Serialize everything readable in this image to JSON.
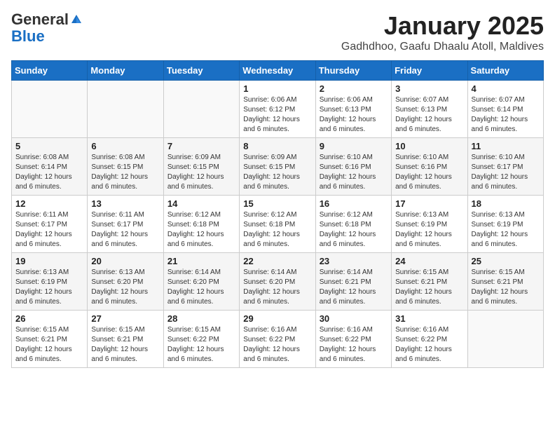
{
  "logo": {
    "general": "General",
    "blue": "Blue"
  },
  "title": "January 2025",
  "subtitle": "Gadhdhoo, Gaafu Dhaalu Atoll, Maldives",
  "headers": [
    "Sunday",
    "Monday",
    "Tuesday",
    "Wednesday",
    "Thursday",
    "Friday",
    "Saturday"
  ],
  "weeks": [
    [
      {
        "day": "",
        "info": ""
      },
      {
        "day": "",
        "info": ""
      },
      {
        "day": "",
        "info": ""
      },
      {
        "day": "1",
        "info": "Sunrise: 6:06 AM\nSunset: 6:12 PM\nDaylight: 12 hours and 6 minutes."
      },
      {
        "day": "2",
        "info": "Sunrise: 6:06 AM\nSunset: 6:13 PM\nDaylight: 12 hours and 6 minutes."
      },
      {
        "day": "3",
        "info": "Sunrise: 6:07 AM\nSunset: 6:13 PM\nDaylight: 12 hours and 6 minutes."
      },
      {
        "day": "4",
        "info": "Sunrise: 6:07 AM\nSunset: 6:14 PM\nDaylight: 12 hours and 6 minutes."
      }
    ],
    [
      {
        "day": "5",
        "info": "Sunrise: 6:08 AM\nSunset: 6:14 PM\nDaylight: 12 hours and 6 minutes."
      },
      {
        "day": "6",
        "info": "Sunrise: 6:08 AM\nSunset: 6:15 PM\nDaylight: 12 hours and 6 minutes."
      },
      {
        "day": "7",
        "info": "Sunrise: 6:09 AM\nSunset: 6:15 PM\nDaylight: 12 hours and 6 minutes."
      },
      {
        "day": "8",
        "info": "Sunrise: 6:09 AM\nSunset: 6:15 PM\nDaylight: 12 hours and 6 minutes."
      },
      {
        "day": "9",
        "info": "Sunrise: 6:10 AM\nSunset: 6:16 PM\nDaylight: 12 hours and 6 minutes."
      },
      {
        "day": "10",
        "info": "Sunrise: 6:10 AM\nSunset: 6:16 PM\nDaylight: 12 hours and 6 minutes."
      },
      {
        "day": "11",
        "info": "Sunrise: 6:10 AM\nSunset: 6:17 PM\nDaylight: 12 hours and 6 minutes."
      }
    ],
    [
      {
        "day": "12",
        "info": "Sunrise: 6:11 AM\nSunset: 6:17 PM\nDaylight: 12 hours and 6 minutes."
      },
      {
        "day": "13",
        "info": "Sunrise: 6:11 AM\nSunset: 6:17 PM\nDaylight: 12 hours and 6 minutes."
      },
      {
        "day": "14",
        "info": "Sunrise: 6:12 AM\nSunset: 6:18 PM\nDaylight: 12 hours and 6 minutes."
      },
      {
        "day": "15",
        "info": "Sunrise: 6:12 AM\nSunset: 6:18 PM\nDaylight: 12 hours and 6 minutes."
      },
      {
        "day": "16",
        "info": "Sunrise: 6:12 AM\nSunset: 6:18 PM\nDaylight: 12 hours and 6 minutes."
      },
      {
        "day": "17",
        "info": "Sunrise: 6:13 AM\nSunset: 6:19 PM\nDaylight: 12 hours and 6 minutes."
      },
      {
        "day": "18",
        "info": "Sunrise: 6:13 AM\nSunset: 6:19 PM\nDaylight: 12 hours and 6 minutes."
      }
    ],
    [
      {
        "day": "19",
        "info": "Sunrise: 6:13 AM\nSunset: 6:19 PM\nDaylight: 12 hours and 6 minutes."
      },
      {
        "day": "20",
        "info": "Sunrise: 6:13 AM\nSunset: 6:20 PM\nDaylight: 12 hours and 6 minutes."
      },
      {
        "day": "21",
        "info": "Sunrise: 6:14 AM\nSunset: 6:20 PM\nDaylight: 12 hours and 6 minutes."
      },
      {
        "day": "22",
        "info": "Sunrise: 6:14 AM\nSunset: 6:20 PM\nDaylight: 12 hours and 6 minutes."
      },
      {
        "day": "23",
        "info": "Sunrise: 6:14 AM\nSunset: 6:21 PM\nDaylight: 12 hours and 6 minutes."
      },
      {
        "day": "24",
        "info": "Sunrise: 6:15 AM\nSunset: 6:21 PM\nDaylight: 12 hours and 6 minutes."
      },
      {
        "day": "25",
        "info": "Sunrise: 6:15 AM\nSunset: 6:21 PM\nDaylight: 12 hours and 6 minutes."
      }
    ],
    [
      {
        "day": "26",
        "info": "Sunrise: 6:15 AM\nSunset: 6:21 PM\nDaylight: 12 hours and 6 minutes."
      },
      {
        "day": "27",
        "info": "Sunrise: 6:15 AM\nSunset: 6:21 PM\nDaylight: 12 hours and 6 minutes."
      },
      {
        "day": "28",
        "info": "Sunrise: 6:15 AM\nSunset: 6:22 PM\nDaylight: 12 hours and 6 minutes."
      },
      {
        "day": "29",
        "info": "Sunrise: 6:16 AM\nSunset: 6:22 PM\nDaylight: 12 hours and 6 minutes."
      },
      {
        "day": "30",
        "info": "Sunrise: 6:16 AM\nSunset: 6:22 PM\nDaylight: 12 hours and 6 minutes."
      },
      {
        "day": "31",
        "info": "Sunrise: 6:16 AM\nSunset: 6:22 PM\nDaylight: 12 hours and 6 minutes."
      },
      {
        "day": "",
        "info": ""
      }
    ]
  ]
}
